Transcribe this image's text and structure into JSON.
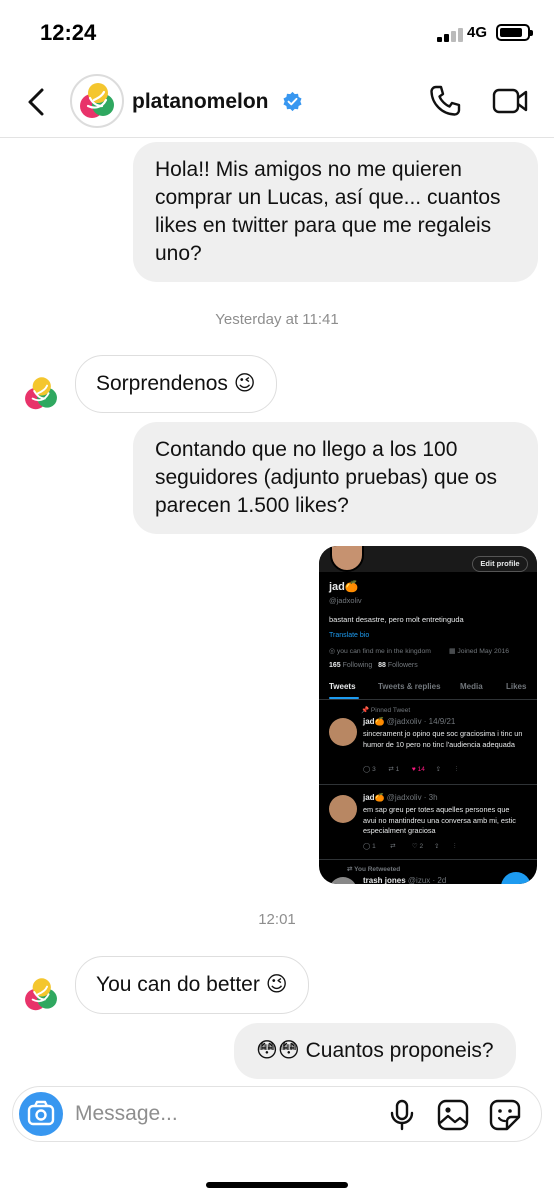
{
  "status_bar": {
    "time": "12:24",
    "network": "4G"
  },
  "header": {
    "username": "platanomelon"
  },
  "messages": {
    "m1": "Hola!! Mis amigos no me quieren comprar un Lucas, así que... cuantos likes en twitter para que me regaleis uno?",
    "ts1": "Yesterday at 11:41",
    "m2": "Sorprendenos 😉",
    "m3": "Contando que no llego a los 100 seguidores (adjunto pruebas) que os parecen 1.500 likes?",
    "ts2": "12:01",
    "m4": "You can do better 😉",
    "m5": "😳😳 Cuantos proponeis?"
  },
  "twitter_profile": {
    "edit_profile": "Edit profile",
    "name": "jad🍊",
    "handle": "@jadxoliv",
    "bio": "bastant desastre, pero molt entretinguda",
    "translate": "Translate bio",
    "location": "you can find me in the kingdom",
    "joined": "Joined May 2016",
    "following_count": "165",
    "following_label": "Following",
    "followers_count": "88",
    "followers_label": "Followers",
    "tabs": [
      "Tweets",
      "Tweets & replies",
      "Media",
      "Likes"
    ],
    "pinned_label": "Pinned Tweet",
    "tweet1": {
      "name": "jad🍊",
      "meta": "@jadxoliv · 14/9/21",
      "text": "sincerament jo opino que soc graciosima i tinc un humor de 10 pero no tinc l'audiencia adequada",
      "replies": "3",
      "retweets": "1",
      "likes": "14"
    },
    "tweet2": {
      "name": "jad🍊",
      "meta": "@jadxoliv · 3h",
      "text": "em sap greu per totes aquelles persones que avui no mantindreu una conversa amb mi, estic especialment graciosa",
      "replies": "1",
      "likes": "2"
    },
    "retweeted_label": "You Retweeted",
    "tweet3": {
      "name": "trash jones",
      "meta": "@izux · 2d"
    }
  },
  "composer": {
    "placeholder": "Message..."
  },
  "colors": {
    "accent": "#3897f0",
    "verified": "#3897f0",
    "bubble_out": "#efefef"
  },
  "icons": [
    "back-chevron-icon",
    "verified-badge-icon",
    "phone-icon",
    "video-camera-icon",
    "camera-icon",
    "microphone-icon",
    "gallery-icon",
    "sticker-icon"
  ]
}
